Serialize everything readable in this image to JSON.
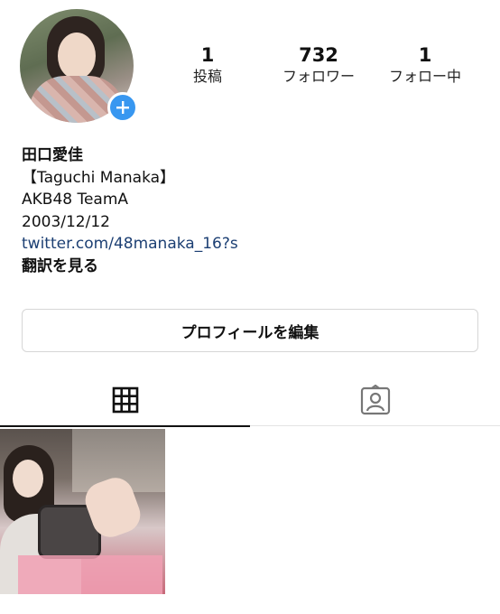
{
  "profile": {
    "stats": {
      "posts_count": "1",
      "posts_label": "投稿",
      "followers_count": "732",
      "followers_label": "フォロワー",
      "following_count": "1",
      "following_label": "フォロー中"
    },
    "bio": {
      "name": "田口愛佳",
      "line1": "【Taguchi Manaka】",
      "line2": "AKB48 TeamA",
      "line3": "2003/12/12",
      "link": "twitter.com/48manaka_16?s",
      "translate": "翻訳を見る"
    },
    "edit_button_label": "プロフィールを編集"
  },
  "tabs": [
    {
      "icon": "grid-icon",
      "active": true
    },
    {
      "icon": "tagged-person-icon",
      "active": false
    }
  ],
  "colors": {
    "accent": "#3897f0",
    "link": "#1c3f73"
  }
}
